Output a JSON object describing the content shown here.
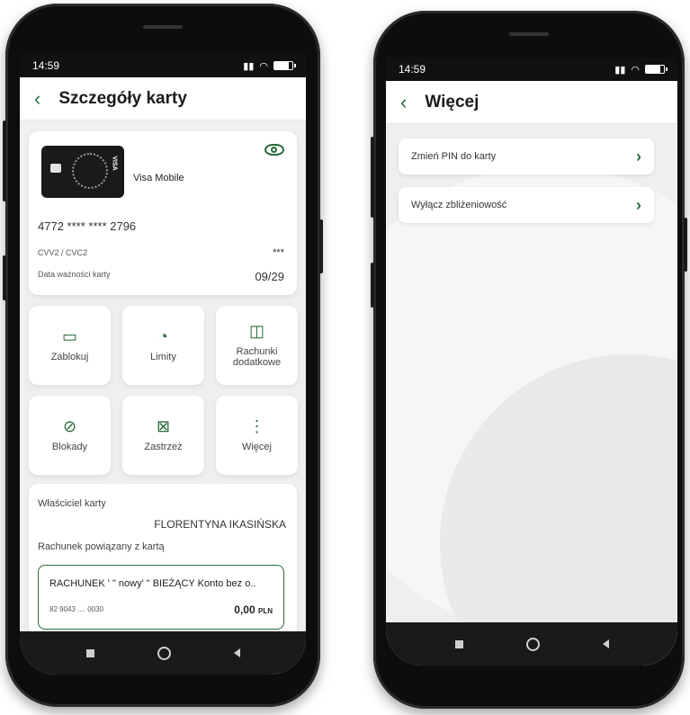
{
  "left_phone": {
    "status": {
      "time": "14:59"
    },
    "appbar": {
      "back_icon": "chevron-left-icon",
      "title": "Szczegóły karty"
    },
    "card": {
      "name": "Visa Mobile",
      "brand": "VISA",
      "eye_icon": "eye-icon",
      "number": "4772 **** **** 2796",
      "cvv_label": "CVV2 / CVC2",
      "cvv_value": "***",
      "expiry_label": "Data ważności karty",
      "expiry_value": "09/29"
    },
    "actions": [
      {
        "label": "Zablokuj",
        "icon": "card-lock-icon"
      },
      {
        "label": "Limity",
        "icon": "gauge-icon"
      },
      {
        "label": "Rachunki dodatkowe",
        "icon": "accounts-icon"
      },
      {
        "label": "Blokady",
        "icon": "block-icon"
      },
      {
        "label": "Zastrzeż",
        "icon": "card-cancel-icon"
      },
      {
        "label": "Więcej",
        "icon": "more-vertical-icon"
      }
    ],
    "owner": {
      "label": "Właściciel karty",
      "name": "FLORENTYNA IKASIŃSKA",
      "account_label": "Rachunek powiązany z kartą",
      "account_title": "RACHUNEK ' \" nowy' \" BIEŻĄCY Konto bez o..",
      "account_number": "82 9043 .... 0030",
      "balance": "0,00",
      "currency": "PLN"
    }
  },
  "right_phone": {
    "status": {
      "time": "14:59"
    },
    "appbar": {
      "back_icon": "chevron-left-icon",
      "title": "Więcej"
    },
    "menu": [
      {
        "label": "Zmień PIN do karty"
      },
      {
        "label": "Wyłącz zbliżeniowość"
      }
    ]
  },
  "colors": {
    "accent": "#2a6b3c",
    "background": "#efefef",
    "card": "#ffffff"
  }
}
